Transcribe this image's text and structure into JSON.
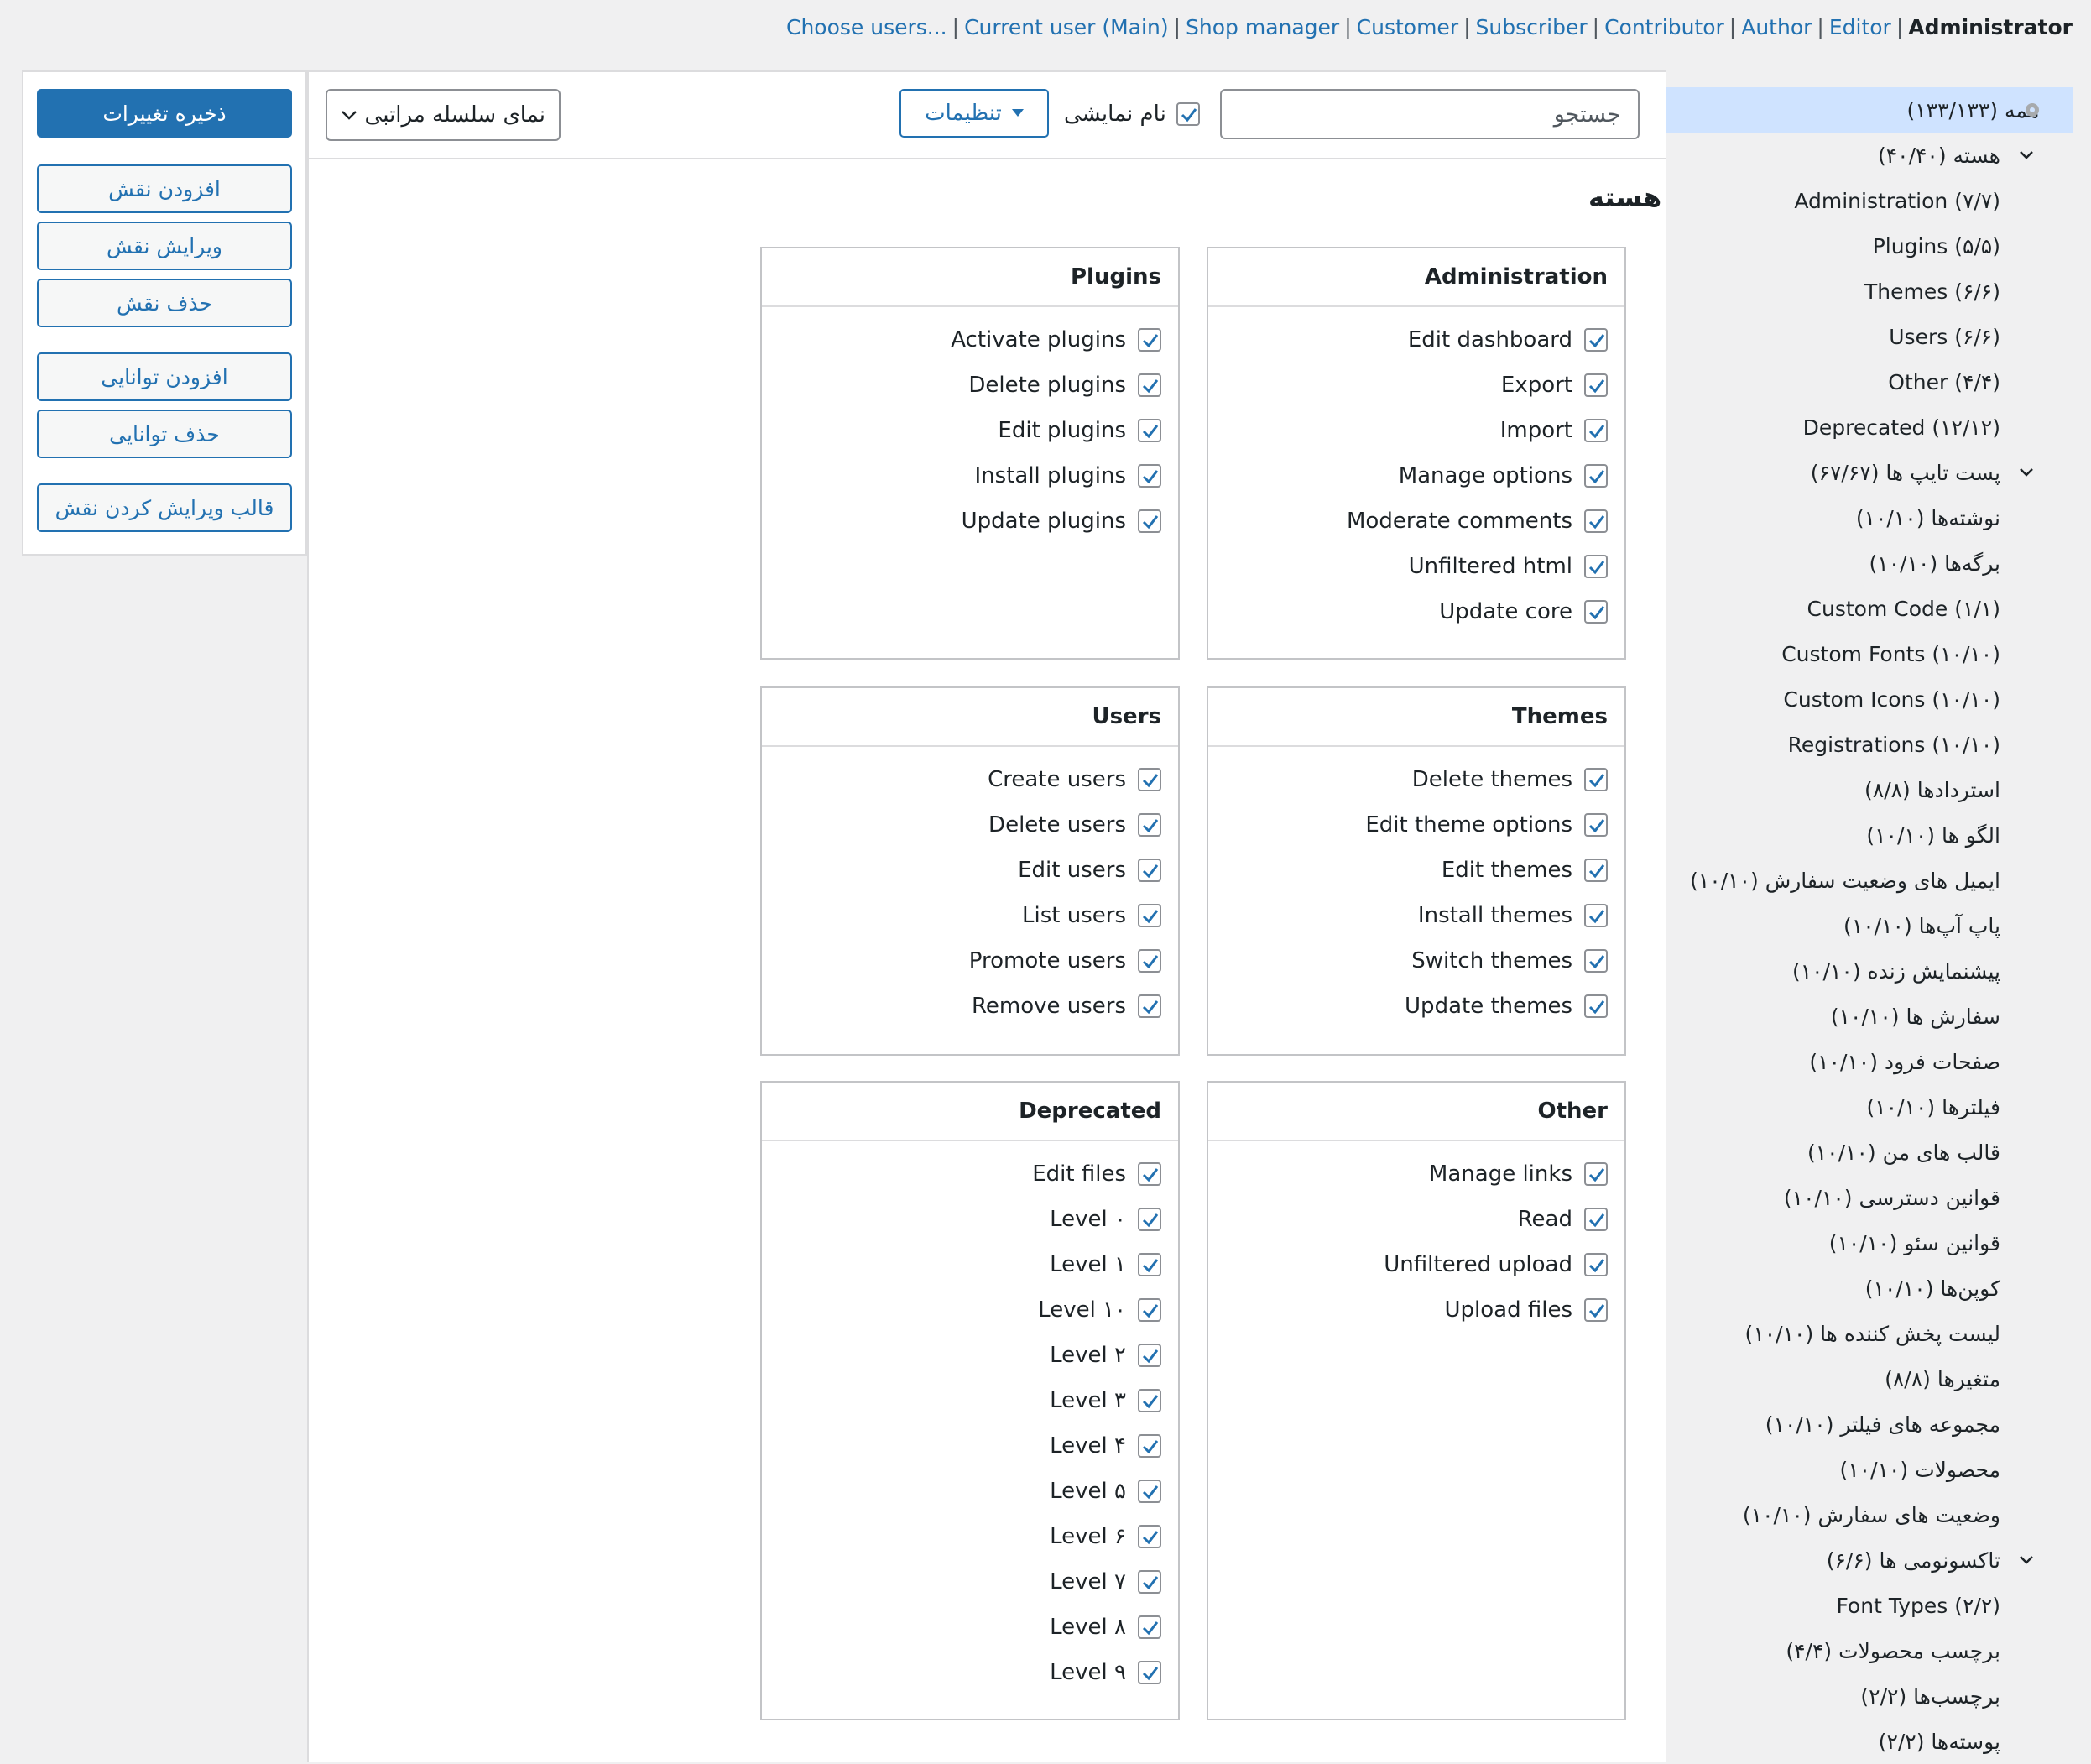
{
  "roles_bar": [
    "Administrator",
    "Editor",
    "Author",
    "Contributor",
    "Subscriber",
    "Customer",
    "Shop manager",
    "Current user (Main)",
    "Choose users..."
  ],
  "current_role": "Administrator",
  "left_buttons": {
    "save": "ذخیره تغییرات",
    "add_role": "افزودن نقش",
    "edit_role": "ویرایش نقش",
    "delete_role": "حذف نقش",
    "add_cap": "افزودن توانایی",
    "delete_cap": "حذف توانایی",
    "role_template": "قالب ویرایش کردن نقش"
  },
  "toolbar": {
    "search_placeholder": "جستجو",
    "display_name_label": "نام نمایشی",
    "display_name_checked": true,
    "settings_label": "تنظیمات",
    "view_select_value": "نمای سلسله مراتبی"
  },
  "section_title": "هسته",
  "groups": {
    "administration": {
      "title": "Administration",
      "items": [
        "Edit dashboard",
        "Export",
        "Import",
        "Manage options",
        "Moderate comments",
        "Unfiltered html",
        "Update core"
      ]
    },
    "plugins": {
      "title": "Plugins",
      "items": [
        "Activate plugins",
        "Delete plugins",
        "Edit plugins",
        "Install plugins",
        "Update plugins"
      ]
    },
    "themes": {
      "title": "Themes",
      "items": [
        "Delete themes",
        "Edit theme options",
        "Edit themes",
        "Install themes",
        "Switch themes",
        "Update themes"
      ]
    },
    "users": {
      "title": "Users",
      "items": [
        "Create users",
        "Delete users",
        "Edit users",
        "List users",
        "Promote users",
        "Remove users"
      ]
    },
    "other": {
      "title": "Other",
      "items": [
        "Manage links",
        "Read",
        "Unfiltered upload",
        "Upload files"
      ]
    },
    "deprecated": {
      "title": "Deprecated",
      "items": [
        "Edit files",
        "Level ۰",
        "Level ۱",
        "Level ۱۰",
        "Level ۲",
        "Level ۳",
        "Level ۴",
        "Level ۵",
        "Level ۶",
        "Level ۷",
        "Level ۸",
        "Level ۹"
      ]
    }
  },
  "accent_color": "#2271b1",
  "selected_tree_bg": "#cfe3ff",
  "tree": [
    {
      "label": "همه (۱۳۳/۱۳۳)",
      "selected": true
    },
    {
      "label": "هسته (۴۰/۴۰)",
      "expandable": true
    },
    {
      "label": "Administration (۷/۷)"
    },
    {
      "label": "Plugins (۵/۵)"
    },
    {
      "label": "Themes (۶/۶)"
    },
    {
      "label": "Users (۶/۶)"
    },
    {
      "label": "Other (۴/۴)"
    },
    {
      "label": "Deprecated (۱۲/۱۲)"
    },
    {
      "label": "پست تایپ ها (۶۷/۶۷)",
      "expandable": true
    },
    {
      "label": "نوشته‌ها (۱۰/۱۰)"
    },
    {
      "label": "برگه‌ها (۱۰/۱۰)"
    },
    {
      "label": "Custom Code (۱/۱)"
    },
    {
      "label": "Custom Fonts (۱۰/۱۰)"
    },
    {
      "label": "Custom Icons (۱۰/۱۰)"
    },
    {
      "label": "Registrations (۱۰/۱۰)"
    },
    {
      "label": "استردادها (۸/۸)"
    },
    {
      "label": "الگو ها (۱۰/۱۰)"
    },
    {
      "label": "ایمیل های وضعیت سفارش (۱۰/۱۰)"
    },
    {
      "label": "پاپ آپ‌ها (۱۰/۱۰)"
    },
    {
      "label": "پیشنمایش زنده (۱۰/۱۰)"
    },
    {
      "label": "سفارش ها (۱۰/۱۰)"
    },
    {
      "label": "صفحات فرود (۱۰/۱۰)"
    },
    {
      "label": "فیلترها (۱۰/۱۰)"
    },
    {
      "label": "قالب های من (۱۰/۱۰)"
    },
    {
      "label": "قوانین دسترسی (۱۰/۱۰)"
    },
    {
      "label": "قوانین سئو (۱۰/۱۰)"
    },
    {
      "label": "کوپن‌ها (۱۰/۱۰)"
    },
    {
      "label": "لیست پخش کننده ها (۱۰/۱۰)"
    },
    {
      "label": "متغیرها (۸/۸)"
    },
    {
      "label": "مجموعه های فیلتر (۱۰/۱۰)"
    },
    {
      "label": "محصولات (۱۰/۱۰)"
    },
    {
      "label": "وضعیت های سفارش (۱۰/۱۰)"
    },
    {
      "label": "تاکسونومی ها (۶/۶)",
      "expandable": true
    },
    {
      "label": "Font Types (۲/۲)"
    },
    {
      "label": "برچسب محصولات (۴/۴)"
    },
    {
      "label": "برچسب‌ها (۲/۲)"
    },
    {
      "label": "پوسته‌ها (۲/۲)"
    }
  ]
}
